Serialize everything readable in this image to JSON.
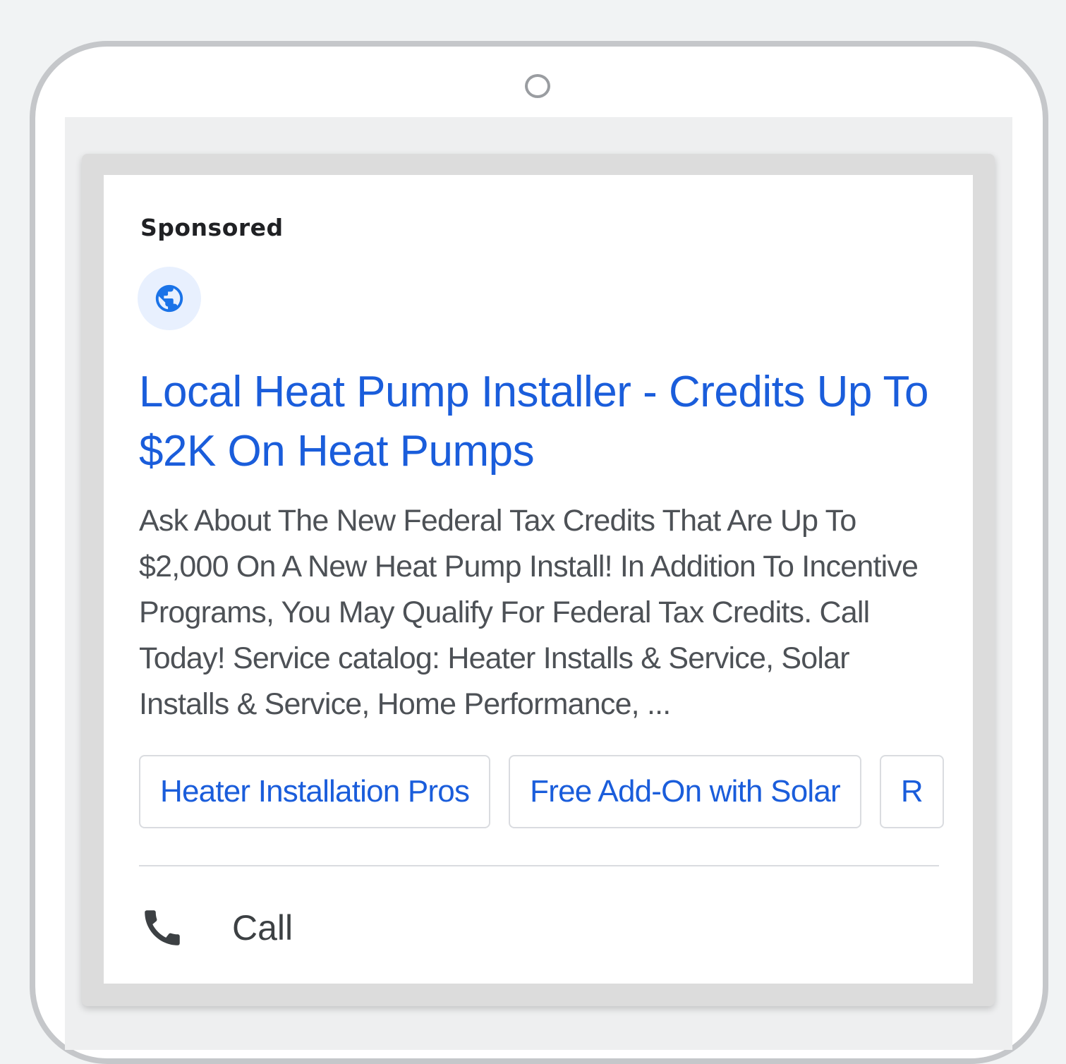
{
  "ad": {
    "label": "Sponsored",
    "favicon_icon": "globe-icon",
    "headline": "Local Heat Pump Installer - Credits Up To $2K On Heat Pumps",
    "description": "Ask About The New Federal Tax Credits That Are Up To $2,000 On A New Heat Pump Install! In Addition To Incentive Programs, You May Qualify For Federal Tax Credits. Call Today! Service catalog: Heater Installs & Service, Solar Installs & Service, Home Performance, ...",
    "sitelinks": [
      {
        "label": "Heater Installation Pros"
      },
      {
        "label": "Free Add-On with Solar"
      },
      {
        "label": "R"
      }
    ],
    "call": {
      "icon": "phone-icon",
      "label": "Call"
    }
  },
  "colors": {
    "link_blue": "#1a5ddb",
    "text_gray": "#4d5156",
    "favicon_bg": "#e8f0fe"
  }
}
